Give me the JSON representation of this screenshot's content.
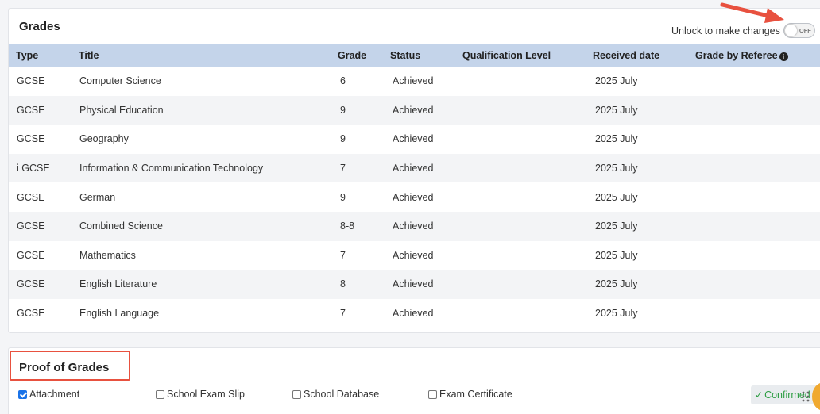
{
  "grades_panel": {
    "title": "Grades",
    "unlock_label": "Unlock to make changes",
    "toggle_text": "OFF",
    "columns": {
      "type": "Type",
      "title": "Title",
      "grade": "Grade",
      "status": "Status",
      "qualification": "Qualification Level",
      "received": "Received date",
      "referee": "Grade by Referee"
    },
    "rows": [
      {
        "type": "GCSE",
        "title": "Computer Science",
        "grade": "6",
        "status": "Achieved",
        "qualification": "",
        "received": "2025 July",
        "referee": ""
      },
      {
        "type": "GCSE",
        "title": "Physical Education",
        "grade": "9",
        "status": "Achieved",
        "qualification": "",
        "received": "2025 July",
        "referee": ""
      },
      {
        "type": "GCSE",
        "title": "Geography",
        "grade": "9",
        "status": "Achieved",
        "qualification": "",
        "received": "2025 July",
        "referee": ""
      },
      {
        "type": "i GCSE",
        "title": "Information & Communication Technology",
        "grade": "7",
        "status": "Achieved",
        "qualification": "",
        "received": "2025 July",
        "referee": ""
      },
      {
        "type": "GCSE",
        "title": "German",
        "grade": "9",
        "status": "Achieved",
        "qualification": "",
        "received": "2025 July",
        "referee": ""
      },
      {
        "type": "GCSE",
        "title": "Combined Science",
        "grade": "8-8",
        "status": "Achieved",
        "qualification": "",
        "received": "2025 July",
        "referee": ""
      },
      {
        "type": "GCSE",
        "title": "Mathematics",
        "grade": "7",
        "status": "Achieved",
        "qualification": "",
        "received": "2025 July",
        "referee": ""
      },
      {
        "type": "GCSE",
        "title": "English Literature",
        "grade": "8",
        "status": "Achieved",
        "qualification": "",
        "received": "2025 July",
        "referee": ""
      },
      {
        "type": "GCSE",
        "title": "English Language",
        "grade": "7",
        "status": "Achieved",
        "qualification": "",
        "received": "2025 July",
        "referee": ""
      }
    ]
  },
  "proof_panel": {
    "title": "Proof of Grades",
    "options": [
      {
        "label": "Attachment",
        "checked": true
      },
      {
        "label": "School Exam Slip",
        "checked": false
      },
      {
        "label": "School Database",
        "checked": false
      },
      {
        "label": "Exam Certificate",
        "checked": false
      }
    ],
    "confirmed_label": "Confirmed"
  },
  "colors": {
    "header_bg": "#c4d4ea",
    "annotation_red": "#e8513f",
    "confirmed_green": "#2e9e44",
    "checkbox_blue": "#1a73e8"
  },
  "icons": [
    "info-icon",
    "check-icon",
    "drag-grip-icon",
    "annotation-arrow"
  ]
}
